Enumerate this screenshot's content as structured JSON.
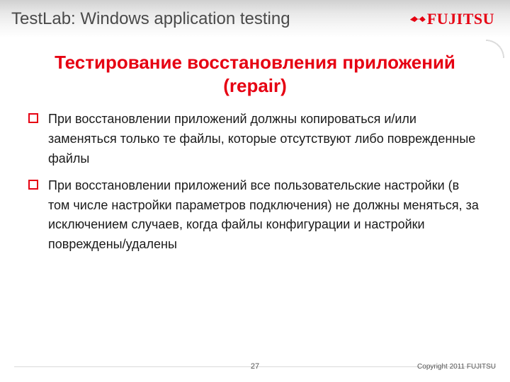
{
  "header": {
    "title": "TestLab: Windows application testing",
    "brand": "FUJITSU"
  },
  "content": {
    "title": "Тестирование восстановления приложений (repair)",
    "bullets": [
      "При восстановлении приложений должны копироваться и/или заменяться только те файлы, которые отсутствуют либо поврежденные файлы",
      "При восстановлении приложений все пользовательские настройки (в том числе настройки параметров подключения) не должны меняться, за исключением случаев, когда файлы конфигурации и настройки повреждены/удалены"
    ]
  },
  "footer": {
    "page": "27",
    "copyright": "Copyright 2011 FUJITSU"
  },
  "colors": {
    "accent": "#e60012"
  }
}
